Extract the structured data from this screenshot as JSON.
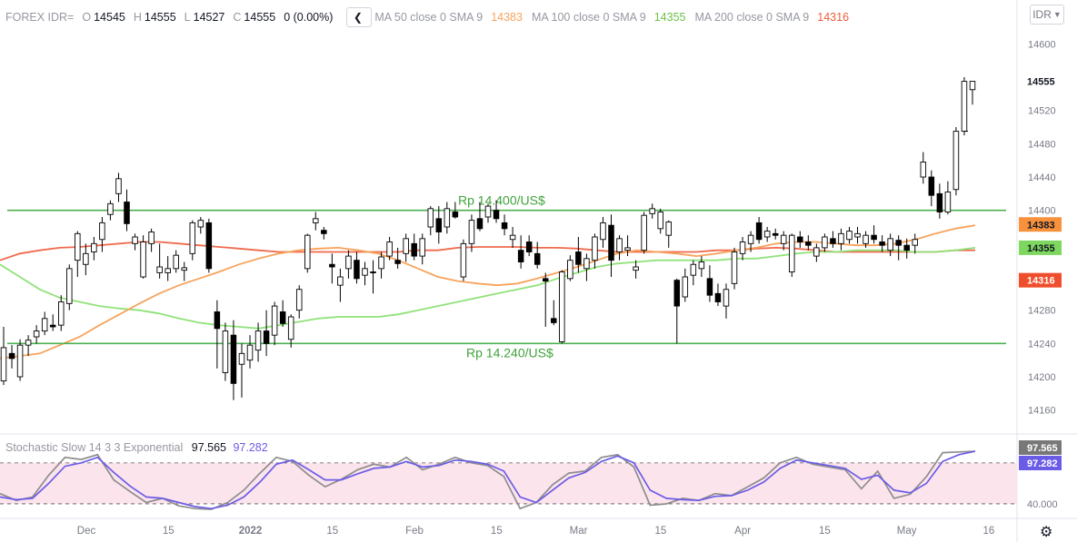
{
  "header": {
    "symbol": "FOREX IDR=",
    "open_label": "O",
    "open": "14545",
    "high_label": "H",
    "high": "14555",
    "low_label": "L",
    "low": "14527",
    "close_label": "C",
    "close": "14555",
    "change": "0 (0.00%)",
    "ma50_label": "MA 50 close 0 SMA 9",
    "ma50_value": "14383",
    "ma100_label": "MA 100 close 0 SMA 9",
    "ma100_value": "14355",
    "ma200_label": "MA 200 close 0 SMA 9",
    "ma200_value": "14316"
  },
  "currency_select": "IDR",
  "stoch": {
    "label": "Stochastic Slow 14 3 3 Exponential",
    "k_value": "97.565",
    "d_value": "97.282",
    "level_label": "40.000"
  },
  "colors": {
    "up_body": "#ffffff",
    "down_body": "#000000",
    "candle_line": "#000000",
    "ma50": "#f7a35c",
    "ma100": "#90e27a",
    "ma200": "#ef6a4c",
    "levels": "#4caf50",
    "stoch_k": "#8d8d8d",
    "stoch_d": "#6b5ce7",
    "stoch_band": "#fce4ec"
  },
  "chart_data": {
    "type": "candlestick",
    "price_axis": {
      "min": 14140,
      "max": 14620,
      "ticks": [
        14160,
        14200,
        14240,
        14280,
        14320,
        14360,
        14400,
        14440,
        14480,
        14520,
        14600
      ]
    },
    "time_axis": {
      "labels": [
        "Dec",
        "15",
        "2022",
        "15",
        "Feb",
        "15",
        "Mar",
        "15",
        "Apr",
        "15",
        "May",
        "16"
      ]
    },
    "levels": [
      {
        "value": 14400,
        "label": "Rp 14.400/US$"
      },
      {
        "value": 14240,
        "label": "Rp 14.240/US$"
      }
    ],
    "last_price": 14555,
    "ma_last": {
      "ma50": 14383,
      "ma100": 14355,
      "ma200": 14316
    },
    "candles": [
      [
        14195,
        14260,
        14190,
        14235
      ],
      [
        14228,
        14238,
        14210,
        14222
      ],
      [
        14200,
        14245,
        14195,
        14238
      ],
      [
        14238,
        14250,
        14225,
        14244
      ],
      [
        14248,
        14262,
        14240,
        14255
      ],
      [
        14255,
        14278,
        14250,
        14270
      ],
      [
        14262,
        14275,
        14255,
        14260
      ],
      [
        14262,
        14298,
        14255,
        14290
      ],
      [
        14288,
        14335,
        14280,
        14330
      ],
      [
        14340,
        14375,
        14320,
        14372
      ],
      [
        14335,
        14360,
        14322,
        14348
      ],
      [
        14350,
        14368,
        14340,
        14360
      ],
      [
        14365,
        14392,
        14350,
        14385
      ],
      [
        14395,
        14412,
        14388,
        14408
      ],
      [
        14420,
        14445,
        14410,
        14438
      ],
      [
        14410,
        14425,
        14375,
        14384
      ],
      [
        14360,
        14372,
        14352,
        14368
      ],
      [
        14320,
        14370,
        14318,
        14362
      ],
      [
        14360,
        14378,
        14350,
        14374
      ],
      [
        14325,
        14360,
        14318,
        14332
      ],
      [
        14325,
        14345,
        14315,
        14330
      ],
      [
        14330,
        14352,
        14325,
        14346
      ],
      [
        14328,
        14338,
        14315,
        14331
      ],
      [
        14348,
        14388,
        14340,
        14385
      ],
      [
        14380,
        14392,
        14372,
        14388
      ],
      [
        14385,
        14390,
        14325,
        14330
      ],
      [
        14278,
        14292,
        14210,
        14258
      ],
      [
        14205,
        14265,
        14195,
        14255
      ],
      [
        14250,
        14268,
        14172,
        14192
      ],
      [
        14215,
        14240,
        14175,
        14228
      ],
      [
        14220,
        14250,
        14210,
        14238
      ],
      [
        14232,
        14265,
        14218,
        14255
      ],
      [
        14255,
        14280,
        14225,
        14240
      ],
      [
        14250,
        14290,
        14238,
        14285
      ],
      [
        14278,
        14292,
        14260,
        14264
      ],
      [
        14245,
        14275,
        14235,
        14272
      ],
      [
        14280,
        14310,
        14270,
        14305
      ],
      [
        14330,
        14372,
        14325,
        14370
      ],
      [
        14385,
        14398,
        14376,
        14390
      ],
      [
        14376,
        14380,
        14365,
        14372
      ],
      [
        14335,
        14348,
        14312,
        14332
      ],
      [
        14310,
        14330,
        14290,
        14320
      ],
      [
        14330,
        14352,
        14318,
        14345
      ],
      [
        14340,
        14350,
        14312,
        14318
      ],
      [
        14322,
        14338,
        14310,
        14330
      ],
      [
        14326,
        14340,
        14300,
        14325
      ],
      [
        14330,
        14350,
        14318,
        14344
      ],
      [
        14345,
        14368,
        14340,
        14362
      ],
      [
        14340,
        14355,
        14330,
        14336
      ],
      [
        14348,
        14372,
        14338,
        14366
      ],
      [
        14360,
        14372,
        14340,
        14345
      ],
      [
        14345,
        14372,
        14335,
        14366
      ],
      [
        14380,
        14405,
        14370,
        14402
      ],
      [
        14390,
        14405,
        14360,
        14374
      ],
      [
        14380,
        14410,
        14372,
        14402
      ],
      [
        14398,
        14410,
        14390,
        14392
      ],
      [
        14320,
        14365,
        14315,
        14360
      ],
      [
        14360,
        14395,
        14350,
        14388
      ],
      [
        14390,
        14410,
        14375,
        14378
      ],
      [
        14392,
        14408,
        14385,
        14405
      ],
      [
        14400,
        14412,
        14385,
        14390
      ],
      [
        14385,
        14395,
        14370,
        14378
      ],
      [
        14365,
        14380,
        14355,
        14370
      ],
      [
        14352,
        14370,
        14330,
        14338
      ],
      [
        14362,
        14370,
        14345,
        14350
      ],
      [
        14348,
        14362,
        14330,
        14335
      ],
      [
        14318,
        14325,
        14260,
        14315
      ],
      [
        14270,
        14292,
        14262,
        14265
      ],
      [
        14242,
        14328,
        14240,
        14326
      ],
      [
        14318,
        14346,
        14315,
        14340
      ],
      [
        14350,
        14368,
        14325,
        14335
      ],
      [
        14330,
        14348,
        14315,
        14342
      ],
      [
        14340,
        14372,
        14330,
        14368
      ],
      [
        14365,
        14392,
        14355,
        14385
      ],
      [
        14382,
        14395,
        14320,
        14340
      ],
      [
        14350,
        14370,
        14340,
        14366
      ],
      [
        14352,
        14370,
        14345,
        14355
      ],
      [
        14328,
        14340,
        14318,
        14332
      ],
      [
        14352,
        14398,
        14348,
        14394
      ],
      [
        14396,
        14408,
        14390,
        14402
      ],
      [
        14378,
        14402,
        14372,
        14398
      ],
      [
        14370,
        14388,
        14355,
        14386
      ],
      [
        14316,
        14318,
        14240,
        14285
      ],
      [
        14296,
        14330,
        14290,
        14320
      ],
      [
        14322,
        14340,
        14310,
        14335
      ],
      [
        14330,
        14345,
        14320,
        14338
      ],
      [
        14318,
        14334,
        14290,
        14298
      ],
      [
        14300,
        14312,
        14285,
        14290
      ],
      [
        14285,
        14312,
        14270,
        14305
      ],
      [
        14312,
        14355,
        14305,
        14350
      ],
      [
        14348,
        14368,
        14340,
        14362
      ],
      [
        14360,
        14375,
        14350,
        14370
      ],
      [
        14385,
        14392,
        14360,
        14365
      ],
      [
        14368,
        14380,
        14362,
        14375
      ],
      [
        14372,
        14378,
        14365,
        14370
      ],
      [
        14360,
        14375,
        14352,
        14370
      ],
      [
        14326,
        14372,
        14320,
        14370
      ],
      [
        14368,
        14375,
        14355,
        14362
      ],
      [
        14362,
        14370,
        14352,
        14358
      ],
      [
        14345,
        14360,
        14338,
        14355
      ],
      [
        14355,
        14372,
        14350,
        14368
      ],
      [
        14366,
        14375,
        14355,
        14360
      ],
      [
        14360,
        14378,
        14352,
        14372
      ],
      [
        14365,
        14380,
        14360,
        14375
      ],
      [
        14368,
        14380,
        14360,
        14372
      ],
      [
        14360,
        14375,
        14355,
        14370
      ],
      [
        14370,
        14382,
        14360,
        14365
      ],
      [
        14362,
        14370,
        14350,
        14358
      ],
      [
        14352,
        14372,
        14345,
        14366
      ],
      [
        14364,
        14370,
        14340,
        14358
      ],
      [
        14358,
        14366,
        14342,
        14352
      ],
      [
        14358,
        14372,
        14348,
        14365
      ],
      [
        14440,
        14470,
        14432,
        14458
      ],
      [
        14440,
        14448,
        14405,
        14418
      ],
      [
        14420,
        14432,
        14390,
        14398
      ],
      [
        14398,
        14435,
        14395,
        14422
      ],
      [
        14425,
        14500,
        14418,
        14495
      ],
      [
        14495,
        14560,
        14490,
        14555
      ],
      [
        14545,
        14555,
        14527,
        14555
      ]
    ],
    "ma50": [
      14222,
      14225,
      14228,
      14238,
      14248,
      14262,
      14275,
      14288,
      14300,
      14310,
      14318,
      14326,
      14335,
      14342,
      14348,
      14352,
      14354,
      14355,
      14352,
      14348,
      14340,
      14330,
      14320,
      14315,
      14312,
      14310,
      14312,
      14318,
      14325,
      14332,
      14340,
      14348,
      14352,
      14350,
      14348,
      14345,
      14348,
      14352,
      14355,
      14360,
      14362,
      14362,
      14360,
      14358,
      14358,
      14360,
      14365,
      14372,
      14378,
      14382
    ],
    "ma100": [
      14335,
      14320,
      14305,
      14295,
      14290,
      14285,
      14282,
      14280,
      14276,
      14270,
      14265,
      14262,
      14260,
      14258,
      14262,
      14266,
      14270,
      14272,
      14272,
      14272,
      14275,
      14280,
      14285,
      14290,
      14295,
      14300,
      14305,
      14310,
      14318,
      14325,
      14332,
      14336,
      14338,
      14340,
      14340,
      14340,
      14340,
      14342,
      14342,
      14345,
      14348,
      14350,
      14350,
      14352,
      14352,
      14352,
      14350,
      14350,
      14352,
      14355
    ],
    "ma200": [
      14340,
      14348,
      14352,
      14355,
      14356,
      14358,
      14360,
      14362,
      14362,
      14360,
      14358,
      14356,
      14354,
      14352,
      14350,
      14350,
      14350,
      14350,
      14350,
      14350,
      14350,
      14352,
      14352,
      14355,
      14356,
      14356,
      14356,
      14355,
      14355,
      14354,
      14352,
      14350,
      14350,
      14350,
      14350,
      14350,
      14352,
      14352,
      14354,
      14355,
      14354,
      14352,
      14350,
      14350,
      14350,
      14350,
      14350,
      14350,
      14352,
      14352
    ],
    "stoch": {
      "range": [
        0,
        100
      ],
      "band": [
        80,
        20
      ],
      "k": [
        35,
        25,
        30,
        62,
        88,
        85,
        92,
        55,
        38,
        22,
        28,
        17,
        13,
        12,
        22,
        40,
        65,
        88,
        82,
        62,
        45,
        56,
        70,
        78,
        74,
        88,
        70,
        78,
        88,
        80,
        76,
        60,
        13,
        22,
        48,
        65,
        68,
        88,
        92,
        74,
        18,
        20,
        28,
        25,
        35,
        32,
        45,
        58,
        80,
        88,
        78,
        74,
        70,
        42,
        68,
        28,
        34,
        60,
        95,
        96,
        97
      ],
      "d": [
        30,
        26,
        28,
        50,
        75,
        80,
        88,
        66,
        46,
        30,
        28,
        22,
        16,
        13,
        18,
        30,
        52,
        78,
        84,
        70,
        55,
        55,
        64,
        72,
        74,
        82,
        74,
        76,
        84,
        82,
        78,
        68,
        30,
        22,
        40,
        58,
        66,
        82,
        90,
        80,
        40,
        28,
        26,
        25,
        31,
        32,
        40,
        52,
        72,
        84,
        80,
        76,
        72,
        56,
        62,
        40,
        36,
        50,
        82,
        92,
        97
      ]
    }
  }
}
